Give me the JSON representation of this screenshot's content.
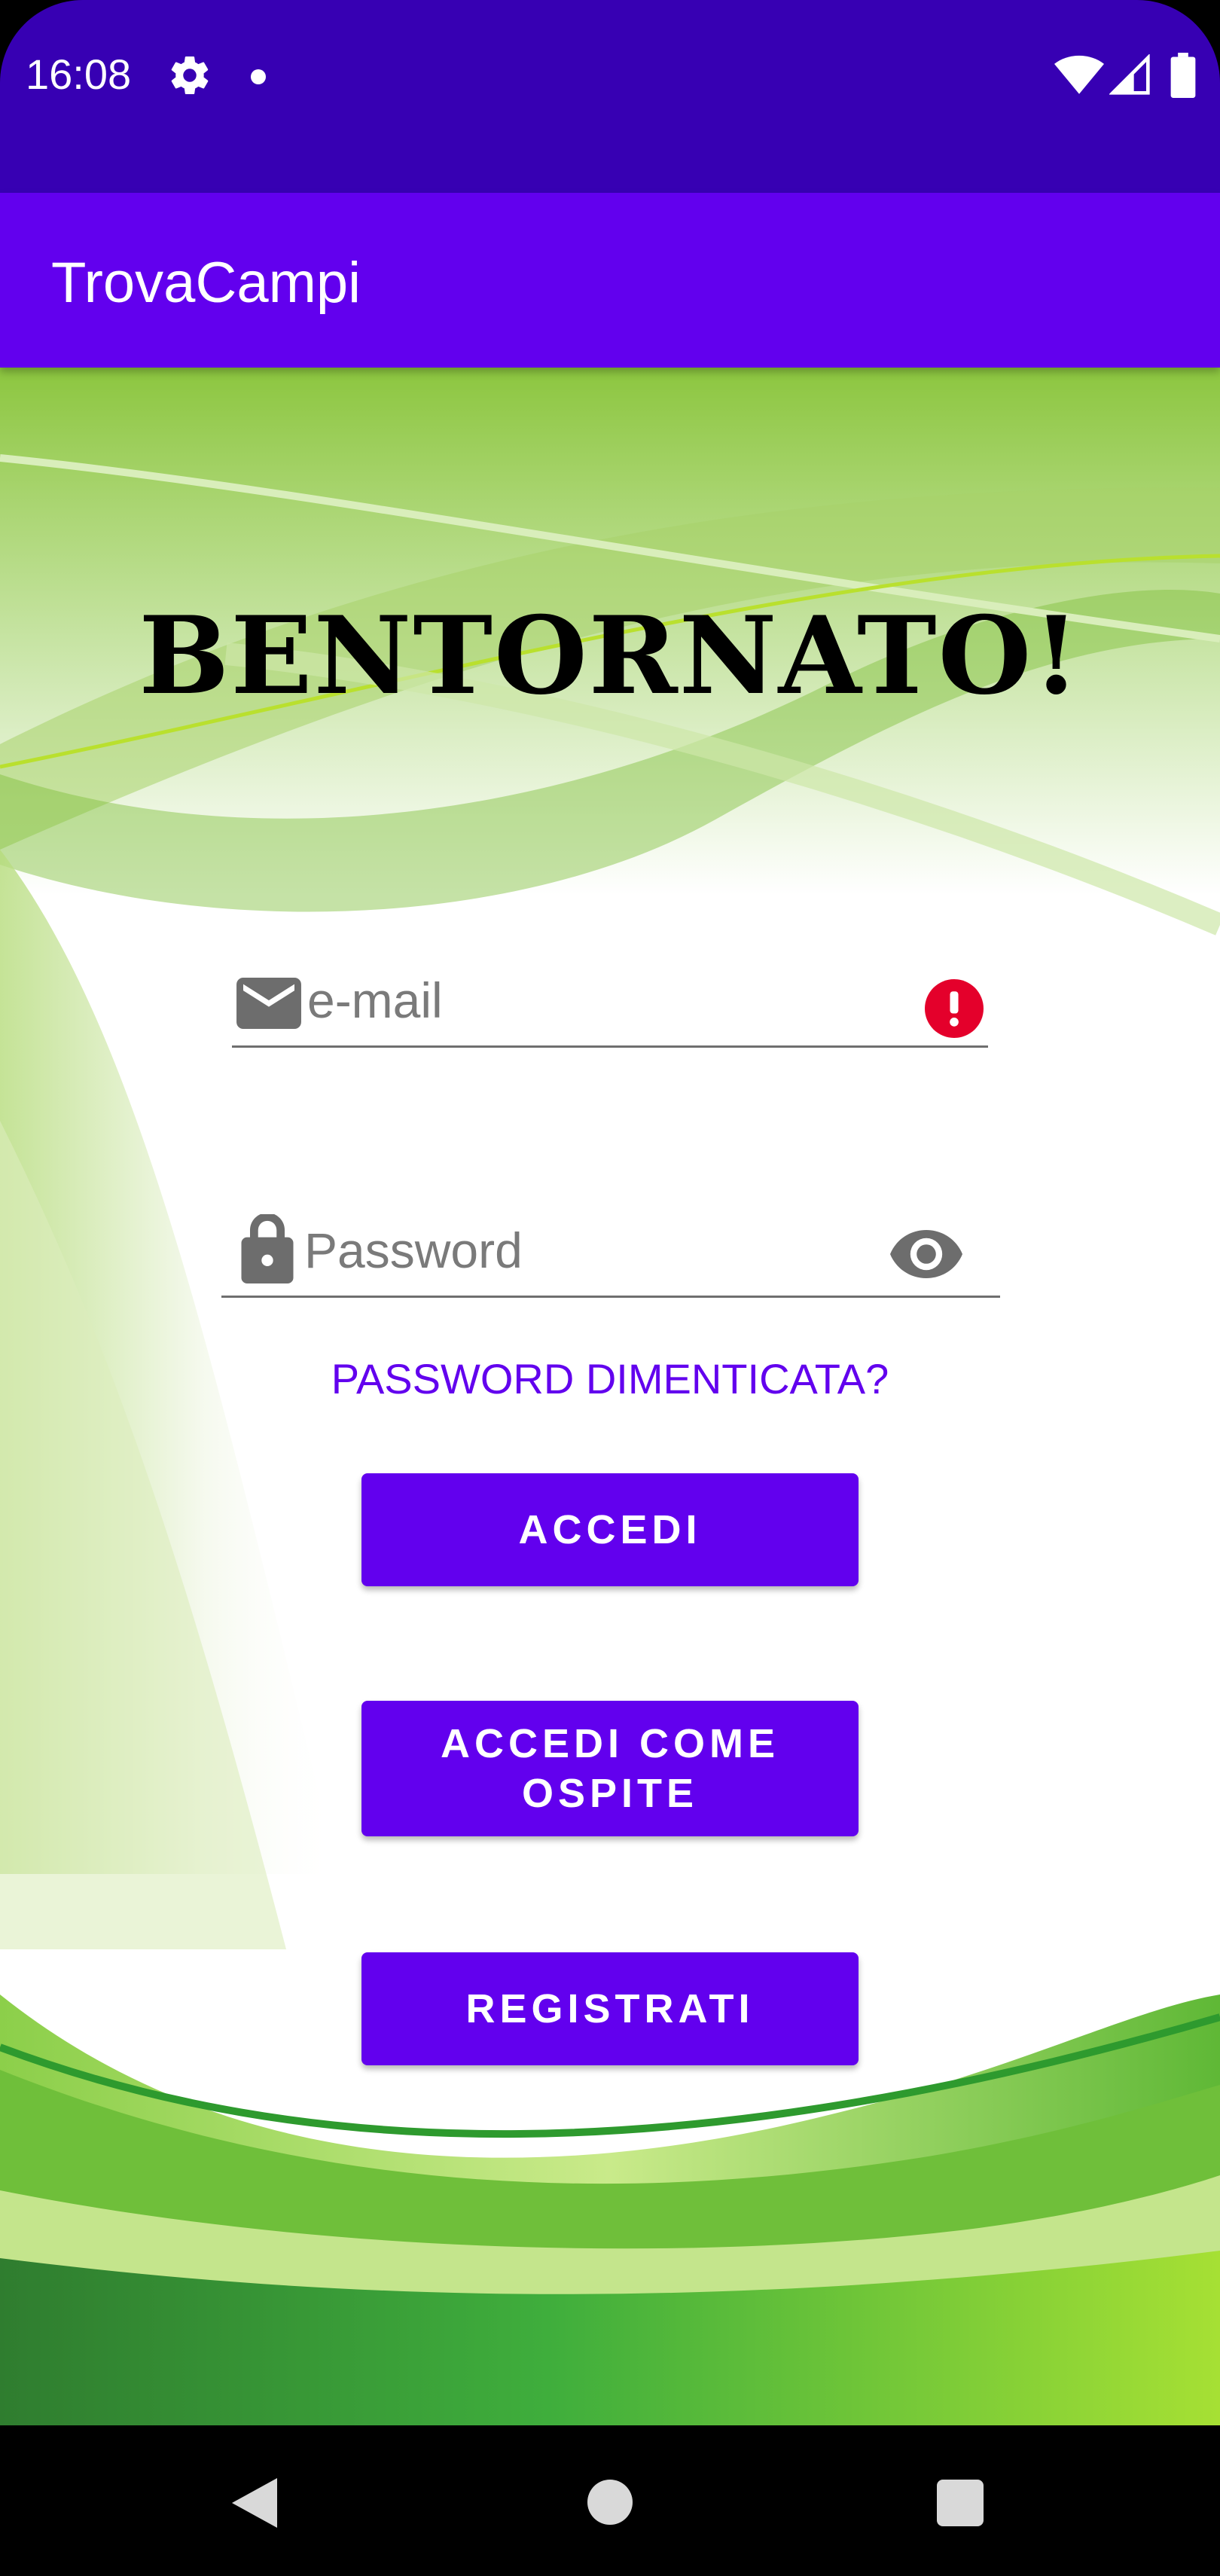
{
  "status_bar": {
    "time": "16:08",
    "icons": [
      "gear-icon",
      "notification-dot-icon",
      "wifi-icon",
      "signal-icon",
      "battery-icon"
    ]
  },
  "app_bar": {
    "title": "TrovaCampi",
    "color": "#6200EE"
  },
  "login": {
    "heading": "BENTORNATO!",
    "email_field": {
      "placeholder": "e-mail",
      "value": "",
      "leading_icon": "mail-icon",
      "trailing_icon": "error-icon",
      "error": true
    },
    "password_field": {
      "placeholder": "Password",
      "value": "",
      "leading_icon": "lock-icon",
      "trailing_icon": "eye-icon"
    },
    "forgot_password_label": "PASSWORD DIMENTICATA?",
    "login_button_label": "ACCEDI",
    "guest_button_label": "ACCEDI COME OSPITE",
    "register_button_label": "REGISTRATI"
  },
  "nav_bar": {
    "icons": [
      "back-icon",
      "home-icon",
      "recent-apps-icon"
    ]
  },
  "colors": {
    "status_bar": "#3700B3",
    "primary": "#6200EE",
    "error": "#E4002B",
    "background_green": "#7CC242"
  }
}
